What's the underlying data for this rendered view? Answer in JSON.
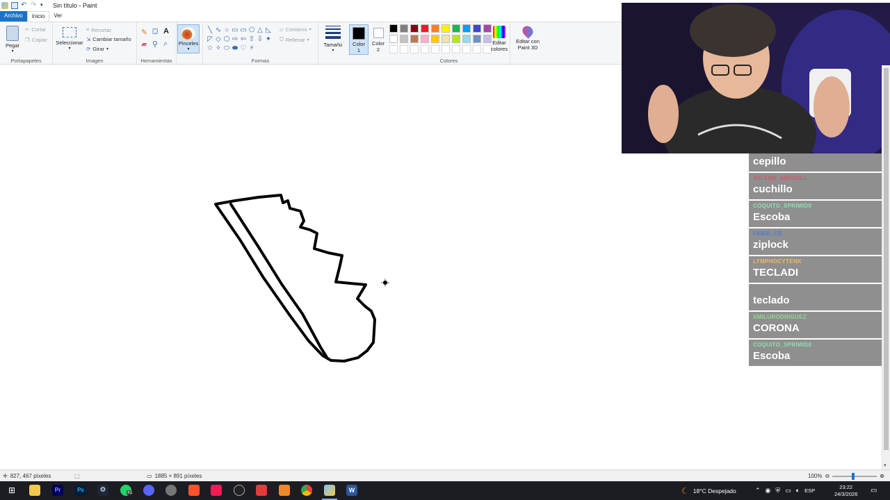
{
  "window": {
    "title": "Sin título - Paint"
  },
  "tabs": [
    {
      "label": "Archivo"
    },
    {
      "label": "Inicio"
    },
    {
      "label": "Ver"
    }
  ],
  "ribbon": {
    "clipboard": {
      "paste_label": "Pegar",
      "cut_label": "Cortar",
      "copy_label": "Copiar",
      "group_label": "Portapapeles"
    },
    "image": {
      "select_label": "Seleccionar",
      "crop_label": "Recortar",
      "resize_label": "Cambiar tamaño",
      "rotate_label": "Girar",
      "group_label": "Imagen"
    },
    "tools": {
      "group_label": "Herramientas",
      "brushes_label": "Pinceles"
    },
    "shapes": {
      "outline_label": "Contorno",
      "fill_label": "Rellenar",
      "group_label": "Formas",
      "glyphs": [
        "╲",
        "∿",
        "○",
        "▭",
        "▭",
        "⬠",
        "△",
        "◺",
        "◸",
        "◇",
        "⬡",
        "⇨",
        "⇦",
        "⇧",
        "⇩",
        "✦",
        "☆",
        "✧",
        "⬭",
        "⬬",
        "♡",
        "⚡"
      ]
    },
    "size_label": "Tamaño",
    "color1_label": "Color 1",
    "color2_label": "Color 2",
    "colors": {
      "group_label": "Colores",
      "row1": [
        "#000000",
        "#7f7f7f",
        "#880015",
        "#ed1c24",
        "#ff7f27",
        "#fff200",
        "#22b14c",
        "#00a2e8",
        "#3f48cc",
        "#a349a4"
      ],
      "row2": [
        "#ffffff",
        "#c3c3c3",
        "#b97a57",
        "#ffaec9",
        "#ffc90e",
        "#efe4b0",
        "#b5e61d",
        "#99d9ea",
        "#7092be",
        "#c8bfe7"
      ]
    },
    "edit_colors_label": "Editar colores",
    "paint3d_label": "Editar con Paint 3D"
  },
  "chat": [
    {
      "user": "",
      "text": "cepillo",
      "color": "#9a9a9a"
    },
    {
      "user": "AYLENN_ABIGAILL",
      "text": "cuchillo",
      "color": "#d9546a"
    },
    {
      "user": "COQUITO_SPRIMID0",
      "text": "Escoba",
      "color": "#8fe0b0"
    },
    {
      "user": "FABRI_CE",
      "text": "ziplock",
      "color": "#4a7bd6"
    },
    {
      "user": "LYMPHOCYTENK",
      "text": "TECLADI",
      "color": "#f0b860"
    },
    {
      "user": "",
      "text": "teclado",
      "color": "#e0a040"
    },
    {
      "user": "XMILURODRIGUEZ",
      "text": "CORONA",
      "color": "#90d890"
    },
    {
      "user": "COQUITO_SPRIMID0",
      "text": "Escoba",
      "color": "#8fe0b0"
    }
  ],
  "status": {
    "cursor_pos": "827, 467 píxeles",
    "canvas_size": "1885 × 891 píxeles",
    "zoom": "100%"
  },
  "taskbar": {
    "weather": "18°C  Despejado",
    "lang": "ESP",
    "time": "23:22",
    "date": "24/3/2026",
    "whatsapp_badge": "41"
  }
}
